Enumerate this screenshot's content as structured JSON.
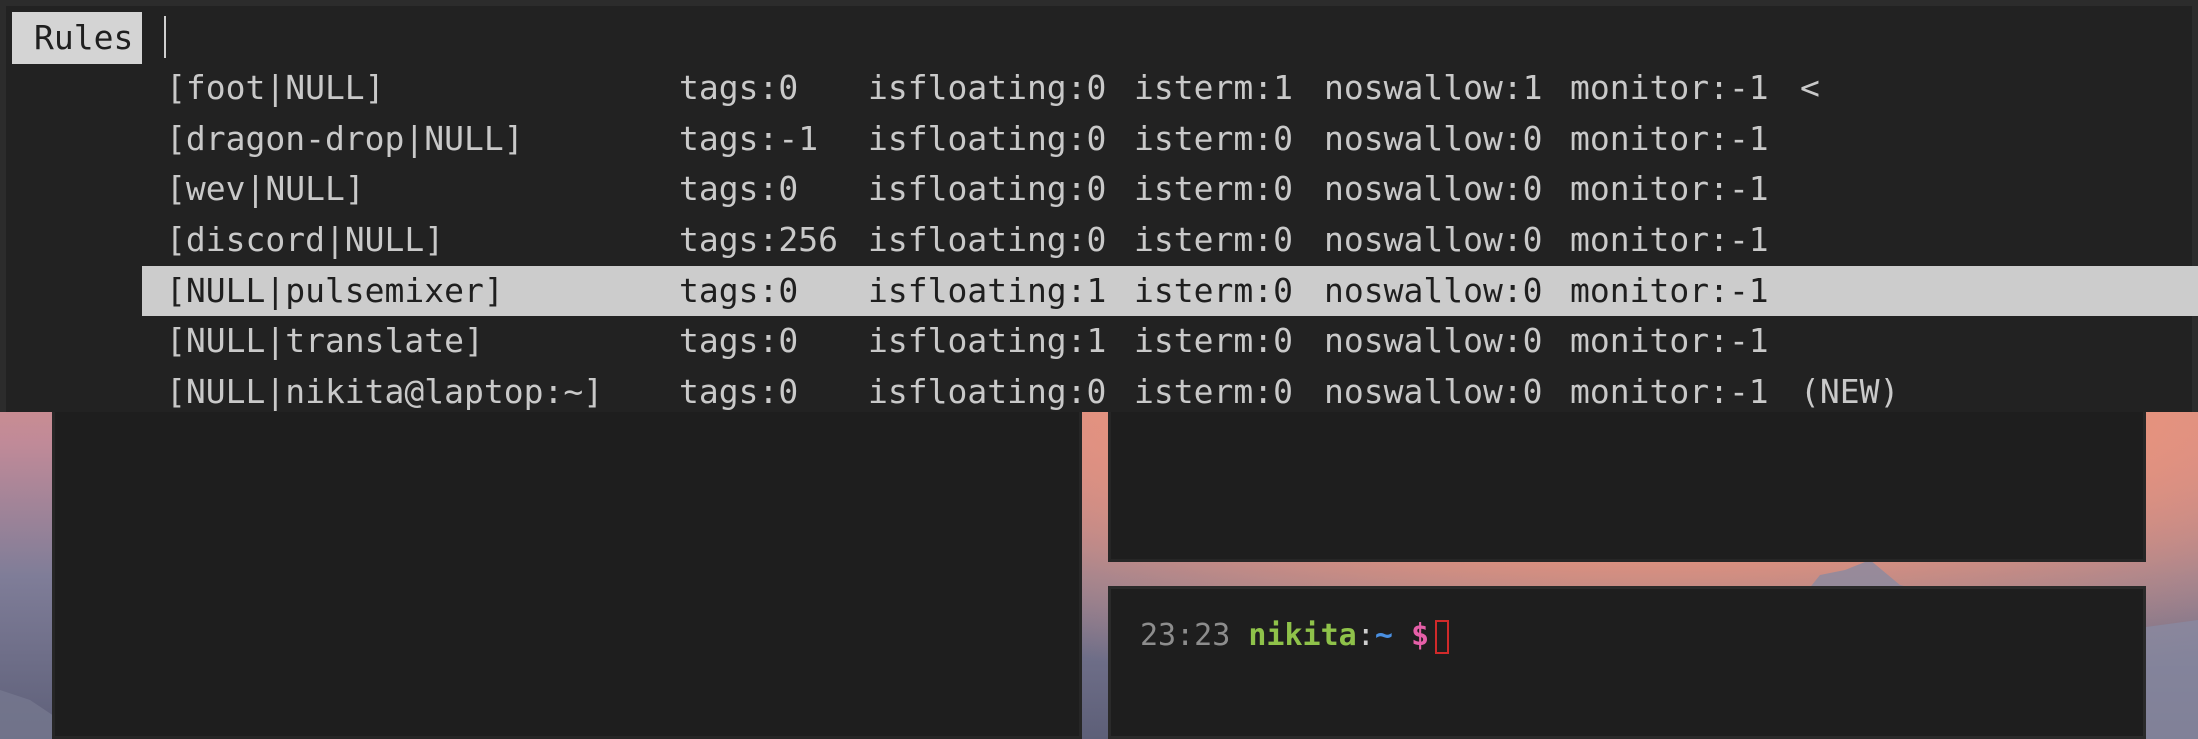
{
  "launcher": {
    "prompt_label": "Rules",
    "input_value": "",
    "rows": [
      {
        "name": "[foot|NULL]",
        "tags": "tags:0",
        "isfloating": "isfloating:0",
        "isterm": "isterm:1",
        "noswallow": "noswallow:1",
        "monitor": "monitor:-1",
        "note": "<"
      },
      {
        "name": "[dragon-drop|NULL]",
        "tags": "tags:-1",
        "isfloating": "isfloating:0",
        "isterm": "isterm:0",
        "noswallow": "noswallow:0",
        "monitor": "monitor:-1",
        "note": ""
      },
      {
        "name": "[wev|NULL]",
        "tags": "tags:0",
        "isfloating": "isfloating:0",
        "isterm": "isterm:0",
        "noswallow": "noswallow:0",
        "monitor": "monitor:-1",
        "note": ""
      },
      {
        "name": "[discord|NULL]",
        "tags": "tags:256",
        "isfloating": "isfloating:0",
        "isterm": "isterm:0",
        "noswallow": "noswallow:0",
        "monitor": "monitor:-1",
        "note": ""
      },
      {
        "name": "[NULL|pulsemixer]",
        "tags": "tags:0",
        "isfloating": "isfloating:1",
        "isterm": "isterm:0",
        "noswallow": "noswallow:0",
        "monitor": "monitor:-1",
        "note": ""
      },
      {
        "name": "[NULL|translate]",
        "tags": "tags:0",
        "isfloating": "isfloating:1",
        "isterm": "isterm:0",
        "noswallow": "noswallow:0",
        "monitor": "monitor:-1",
        "note": ""
      },
      {
        "name": "[NULL|nikita@laptop:~]",
        "tags": "tags:0",
        "isfloating": "isfloating:0",
        "isterm": "isterm:0",
        "noswallow": "noswallow:0",
        "monitor": "monitor:-1",
        "note": "(NEW)"
      }
    ],
    "selected_index": 4
  },
  "terminal": {
    "time": "23:23",
    "user": "nikita",
    "colon": ":",
    "path": "~",
    "dollar": "$"
  },
  "colors": {
    "menu_bg": "#222222",
    "selected_bg": "#cccccc",
    "prompt_user": "#8fc24a",
    "prompt_path": "#4a90e2",
    "prompt_dollar": "#e55fa8",
    "cursor": "#d12a2a"
  }
}
